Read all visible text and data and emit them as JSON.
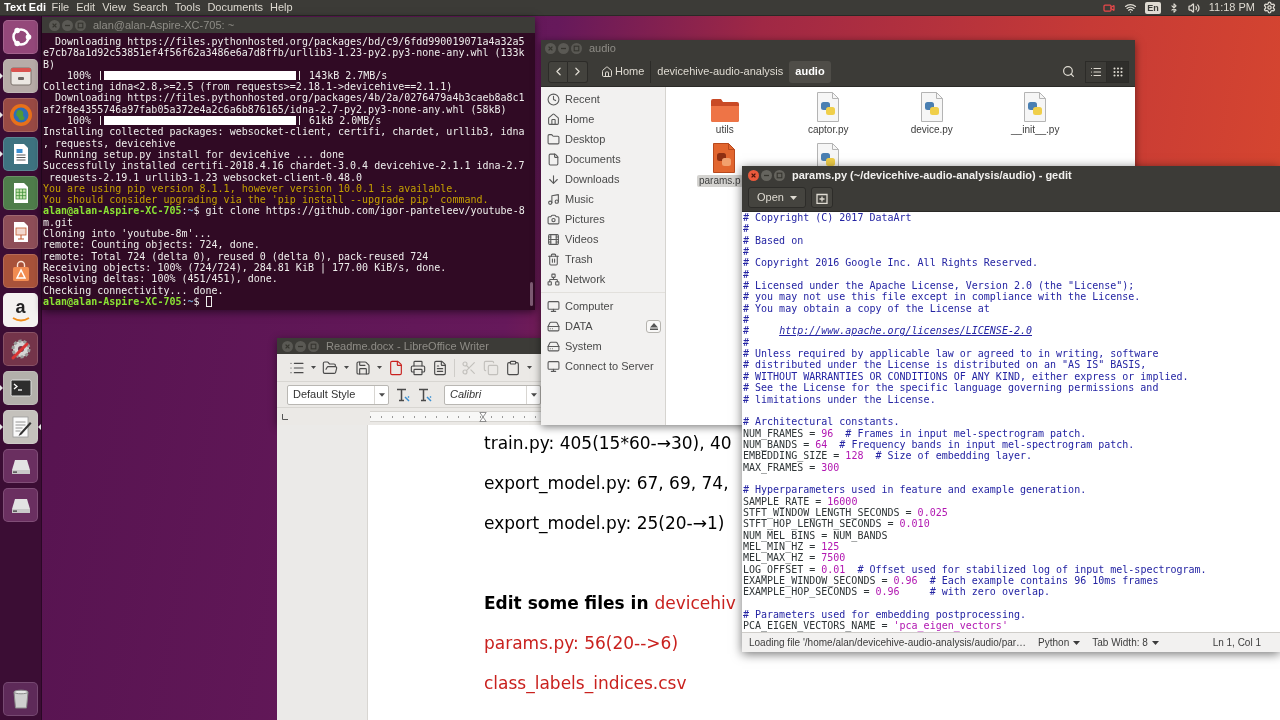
{
  "top_bar": {
    "app_name": "Text Edi",
    "menu": [
      "File",
      "Edit",
      "View",
      "Search",
      "Tools",
      "Documents",
      "Help"
    ],
    "keyboard_layout": "En",
    "clock": "11:18 PM"
  },
  "launcher": [
    {
      "kind": "ubuntu",
      "running": false,
      "focused": false
    },
    {
      "kind": "files",
      "running": true,
      "focused": false
    },
    {
      "kind": "browser",
      "running": true,
      "focused": false
    },
    {
      "kind": "writer",
      "running": true,
      "focused": false
    },
    {
      "kind": "calc",
      "running": false,
      "focused": false
    },
    {
      "kind": "impress",
      "running": false,
      "focused": false
    },
    {
      "kind": "software",
      "running": false,
      "focused": false
    },
    {
      "kind": "letter",
      "glyph": "a",
      "running": false,
      "focused": false
    },
    {
      "kind": "settings",
      "running": false,
      "focused": false
    },
    {
      "kind": "terminal",
      "running": true,
      "focused": false
    },
    {
      "kind": "editor",
      "running": true,
      "focused": true
    },
    {
      "kind": "drive",
      "running": false,
      "focused": false
    },
    {
      "kind": "drive",
      "running": false,
      "focused": false
    },
    {
      "kind": "trash",
      "running": false,
      "focused": false
    }
  ],
  "terminal": {
    "title": "alan@alan-Aspire-XC-705: ~",
    "active": false,
    "cursor": true,
    "lines": [
      {
        "kind": "output",
        "text": "  Downloading https://files.pythonhosted.org/packages/bd/c9/6fdd990019071a4a32a5"
      },
      {
        "kind": "output",
        "text": "e7cb78a1d92c53851ef4f56f62a3486e6a7d8ffb/urllib3-1.23-py2.py3-none-any.whl (133k"
      },
      {
        "kind": "output",
        "text": "B)"
      },
      {
        "kind": "progress",
        "percent": "100%",
        "level": 1,
        "reading": "143kB 2.7MB/s"
      },
      {
        "kind": "output",
        "text": "Collecting idna<2.8,>=2.5 (from requests>=2.18.1->devicehive==2.1.1)"
      },
      {
        "kind": "output",
        "text": "  Downloading https://files.pythonhosted.org/packages/4b/2a/0276479a4b3caeb8a8c1"
      },
      {
        "kind": "output",
        "text": "af2f8e4355746a97fab05a372e4a2c6a6b876165/idna-2.7-py2.py3-none-any.whl (58kB)"
      },
      {
        "kind": "progress",
        "percent": "100%",
        "level": 1,
        "reading": "61kB 2.0MB/s"
      },
      {
        "kind": "output",
        "text": "Installing collected packages: websocket-client, certifi, chardet, urllib3, idna"
      },
      {
        "kind": "output",
        "text": ", requests, devicehive"
      },
      {
        "kind": "output",
        "text": "  Running setup.py install for devicehive ... done"
      },
      {
        "kind": "output",
        "text": "Successfully installed certifi-2018.4.16 chardet-3.0.4 devicehive-2.1.1 idna-2.7"
      },
      {
        "kind": "output",
        "text": " requests-2.19.1 urllib3-1.23 websocket-client-0.48.0"
      },
      {
        "kind": "warning",
        "text": "You are using pip version 8.1.1, however version 10.0.1 is available."
      },
      {
        "kind": "warning",
        "text": "You should consider upgrading via the 'pip install --upgrade pip' command."
      },
      {
        "kind": "prompt",
        "segments": [
          {
            "kind": "user",
            "text": "alan@alan-Aspire-XC-705"
          },
          {
            "kind": "plain",
            "text": ":"
          },
          {
            "kind": "path",
            "text": "~"
          },
          {
            "kind": "plain",
            "text": "$ git clone https://github.com/igor-panteleev/youtube-8"
          }
        ]
      },
      {
        "kind": "output",
        "text": "m.git"
      },
      {
        "kind": "output",
        "text": "Cloning into 'youtube-8m'..."
      },
      {
        "kind": "output",
        "text": "remote: Counting objects: 724, done."
      },
      {
        "kind": "output",
        "text": "remote: Total 724 (delta 0), reused 0 (delta 0), pack-reused 724"
      },
      {
        "kind": "output",
        "text": "Receiving objects: 100% (724/724), 284.81 KiB | 177.00 KiB/s, done."
      },
      {
        "kind": "output",
        "text": "Resolving deltas: 100% (451/451), done."
      },
      {
        "kind": "output",
        "text": "Checking connectivity... done."
      },
      {
        "kind": "prompt",
        "segments": [
          {
            "kind": "user",
            "text": "alan@alan-Aspire-XC-705"
          },
          {
            "kind": "plain",
            "text": ":"
          },
          {
            "kind": "path",
            "text": "~"
          },
          {
            "kind": "plain",
            "text": "$ "
          }
        ]
      }
    ]
  },
  "writer": {
    "title": "Readme.docx - LibreOffice Writer",
    "active": false,
    "toolbar": [
      {
        "kind": "sidebar",
        "disabled": false,
        "has_menu": true
      },
      {
        "kind": "open",
        "disabled": false,
        "has_menu": true
      },
      {
        "kind": "save",
        "disabled": false,
        "has_menu": true
      },
      {
        "kind": "pdf",
        "disabled": false,
        "has_menu": false
      },
      {
        "kind": "print",
        "disabled": false,
        "has_menu": false
      },
      {
        "kind": "preview",
        "disabled": false,
        "has_menu": false
      },
      {
        "kind": "separator"
      },
      {
        "kind": "cut",
        "disabled": true,
        "has_menu": false
      },
      {
        "kind": "copy",
        "disabled": true,
        "has_menu": false
      },
      {
        "kind": "paste",
        "disabled": false,
        "has_menu": true
      }
    ],
    "paragraph_style": "Default Style",
    "font_name": "Calibri",
    "document": [
      [
        {
          "segments": [
            {
              "text": "train.py: 405(15*60-→30), 40",
              "bold": false,
              "color": "#000000"
            }
          ]
        },
        {
          "segments": [
            {
              "text": "export_model.py: 67, 69, 74,",
              "bold": false,
              "color": "#000000"
            }
          ]
        },
        {
          "segments": [
            {
              "text": "export_model.py: 25(20-→1)",
              "bold": false,
              "color": "#000000"
            }
          ]
        }
      ],
      [
        {
          "segments": [
            {
              "text": "Edit some files in ",
              "bold": true,
              "color": "#000000"
            },
            {
              "text": "devicehiv",
              "bold": false,
              "color": "#c9211e"
            }
          ]
        },
        {
          "segments": [
            {
              "text": "params.py: 56(20-->6)",
              "bold": false,
              "color": "#c9211e"
            }
          ]
        },
        {
          "segments": [
            {
              "text": "class_labels_indices.csv",
              "bold": false,
              "color": "#c9211e"
            }
          ]
        }
      ]
    ]
  },
  "file_manager": {
    "title": "audio",
    "active": false,
    "path": [
      {
        "kind": "home",
        "label": "Home",
        "selected": false
      },
      {
        "kind": "folder",
        "label": "devicehive-audio-analysis",
        "selected": false
      },
      {
        "kind": "folder",
        "label": "audio",
        "selected": true
      }
    ],
    "view_buttons": [
      {
        "kind": "list",
        "selected": false
      },
      {
        "kind": "grid",
        "selected": true
      }
    ],
    "sidebar": [
      [
        {
          "kind": "recent",
          "label": "Recent",
          "ejectable": false
        },
        {
          "kind": "home",
          "label": "Home",
          "ejectable": false
        },
        {
          "kind": "desktop",
          "label": "Desktop",
          "ejectable": false
        },
        {
          "kind": "documents",
          "label": "Documents",
          "ejectable": false
        },
        {
          "kind": "downloads",
          "label": "Downloads",
          "ejectable": false
        },
        {
          "kind": "music",
          "label": "Music",
          "ejectable": false
        },
        {
          "kind": "pictures",
          "label": "Pictures",
          "ejectable": false
        },
        {
          "kind": "videos",
          "label": "Videos",
          "ejectable": false
        },
        {
          "kind": "trash",
          "label": "Trash",
          "ejectable": false
        },
        {
          "kind": "network",
          "label": "Network",
          "ejectable": false
        }
      ],
      [
        {
          "kind": "computer",
          "label": "Computer",
          "ejectable": false
        },
        {
          "kind": "drive",
          "label": "DATA",
          "ejectable": true
        },
        {
          "kind": "drive",
          "label": "System",
          "ejectable": false
        },
        {
          "kind": "server",
          "label": "Connect to Server",
          "ejectable": false
        }
      ]
    ],
    "files": [
      {
        "kind": "folder",
        "name": "utils",
        "selected": false,
        "clipped_right": false,
        "clipped_bottom": false
      },
      {
        "kind": "script",
        "name": "captor.py",
        "selected": false,
        "clipped_right": false,
        "clipped_bottom": false
      },
      {
        "kind": "script",
        "name": "device.py",
        "selected": false,
        "clipped_right": false,
        "clipped_bottom": false
      },
      {
        "kind": "script",
        "name": "__init__.py",
        "selected": false,
        "clipped_right": false,
        "clipped_bottom": false
      },
      {
        "kind": "script",
        "name": "params.p",
        "selected": true,
        "clipped_right": true,
        "clipped_bottom": false
      },
      {
        "kind": "script",
        "selected": false,
        "clipped_right": false,
        "clipped_bottom": true
      }
    ]
  },
  "editor": {
    "title": "params.py (~/devicehive-audio-analysis/audio) - gedit",
    "active": true,
    "open_button": "Open",
    "code_blocks": [
      [
        [
          {
            "kind": "comment",
            "text": "# Copyright (C) 2017 DataArt"
          }
        ],
        [
          {
            "kind": "comment",
            "text": "#"
          }
        ],
        [
          {
            "kind": "comment",
            "text": "# Based on"
          }
        ],
        [
          {
            "kind": "comment",
            "text": "#"
          }
        ],
        [
          {
            "kind": "comment",
            "text": "# Copyright 2016 Google Inc. All Rights Reserved."
          }
        ],
        [
          {
            "kind": "comment",
            "text": "#"
          }
        ],
        [
          {
            "kind": "comment",
            "text": "# Licensed under the Apache License, Version 2.0 (the \"License\");"
          }
        ],
        [
          {
            "kind": "comment",
            "text": "# you may not use this file except in compliance with the License."
          }
        ],
        [
          {
            "kind": "comment",
            "text": "# You may obtain a copy of the License at"
          }
        ],
        [
          {
            "kind": "comment",
            "text": "#"
          }
        ],
        [
          {
            "kind": "comment",
            "text": "#     "
          },
          {
            "kind": "link",
            "text": "http://www.apache.org/licenses/LICENSE-2.0"
          }
        ],
        [
          {
            "kind": "comment",
            "text": "#"
          }
        ],
        [
          {
            "kind": "comment",
            "text": "# Unless required by applicable law or agreed to in writing, software"
          }
        ],
        [
          {
            "kind": "comment",
            "text": "# distributed under the License is distributed on an \"AS IS\" BASIS,"
          }
        ],
        [
          {
            "kind": "comment",
            "text": "# WITHOUT WARRANTIES OR CONDITIONS OF ANY KIND, either express or implied."
          }
        ],
        [
          {
            "kind": "comment",
            "text": "# See the License for the specific language governing permissions and"
          }
        ],
        [
          {
            "kind": "comment",
            "text": "# limitations under the License."
          }
        ]
      ],
      [
        [
          {
            "kind": "comment",
            "text": "# Architectural constants."
          }
        ],
        [
          {
            "kind": "plain",
            "text": "NUM_FRAMES = "
          },
          {
            "kind": "number",
            "text": "96"
          },
          {
            "kind": "comment",
            "text": "  # Frames in input mel-spectrogram patch."
          }
        ],
        [
          {
            "kind": "plain",
            "text": "NUM_BANDS = "
          },
          {
            "kind": "number",
            "text": "64"
          },
          {
            "kind": "comment",
            "text": "  # Frequency bands in input mel-spectrogram patch."
          }
        ],
        [
          {
            "kind": "plain",
            "text": "EMBEDDING_SIZE = "
          },
          {
            "kind": "number",
            "text": "128"
          },
          {
            "kind": "comment",
            "text": "  # Size of embedding layer."
          }
        ],
        [
          {
            "kind": "plain",
            "text": "MAX_FRAMES = "
          },
          {
            "kind": "number",
            "text": "300"
          }
        ]
      ],
      [
        [
          {
            "kind": "comment",
            "text": "# Hyperparameters used in feature and example generation."
          }
        ],
        [
          {
            "kind": "plain",
            "text": "SAMPLE_RATE = "
          },
          {
            "kind": "number",
            "text": "16000"
          }
        ],
        [
          {
            "kind": "plain",
            "text": "STFT_WINDOW_LENGTH_SECONDS = "
          },
          {
            "kind": "number",
            "text": "0.025"
          }
        ],
        [
          {
            "kind": "plain",
            "text": "STFT_HOP_LENGTH_SECONDS = "
          },
          {
            "kind": "number",
            "text": "0.010"
          }
        ],
        [
          {
            "kind": "plain",
            "text": "NUM_MEL_BINS = NUM_BANDS"
          }
        ],
        [
          {
            "kind": "plain",
            "text": "MEL_MIN_HZ = "
          },
          {
            "kind": "number",
            "text": "125"
          }
        ],
        [
          {
            "kind": "plain",
            "text": "MEL_MAX_HZ = "
          },
          {
            "kind": "number",
            "text": "7500"
          }
        ],
        [
          {
            "kind": "plain",
            "text": "LOG_OFFSET = "
          },
          {
            "kind": "number",
            "text": "0.01"
          },
          {
            "kind": "comment",
            "text": "  # Offset used for stabilized log of input mel-spectrogram."
          }
        ],
        [
          {
            "kind": "plain",
            "text": "EXAMPLE_WINDOW_SECONDS = "
          },
          {
            "kind": "number",
            "text": "0.96"
          },
          {
            "kind": "comment",
            "text": "  # Each example contains 96 10ms frames"
          }
        ],
        [
          {
            "kind": "plain",
            "text": "EXAMPLE_HOP_SECONDS = "
          },
          {
            "kind": "number",
            "text": "0.96"
          },
          {
            "kind": "comment",
            "text": "     # with zero overlap."
          }
        ]
      ],
      [
        [
          {
            "kind": "comment",
            "text": "# Parameters used for embedding postprocessing."
          }
        ],
        [
          {
            "kind": "plain",
            "text": "PCA_EIGEN_VECTORS_NAME = "
          },
          {
            "kind": "string",
            "text": "'pca_eigen_vectors'"
          }
        ]
      ]
    ],
    "status_bar": {
      "message": "Loading file '/home/alan/devicehive-audio-analysis/audio/par…",
      "language": "Python",
      "tab_width": "Tab Width: 8",
      "position": "Ln 1, Col 1"
    }
  }
}
